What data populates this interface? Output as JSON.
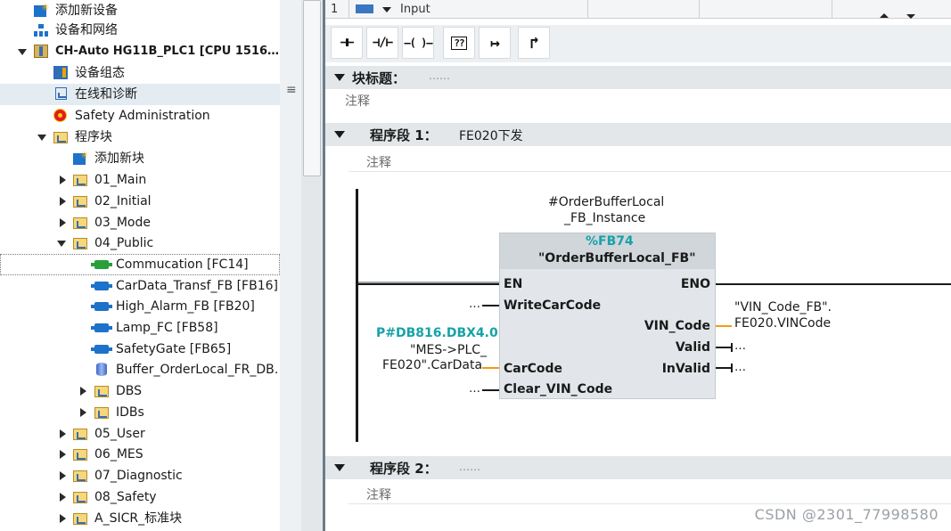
{
  "tree": {
    "items": [
      {
        "label": "添加新设备",
        "icon": "add-device-icon"
      },
      {
        "label": "设备和网络",
        "icon": "network-icon"
      },
      {
        "label": "CH-Auto HG11B_PLC1 [CPU 1516…",
        "icon": "plc-icon"
      },
      {
        "label": "设备组态",
        "icon": "device-config-icon"
      },
      {
        "label": "在线和诊断",
        "icon": "diagnostics-icon"
      },
      {
        "label": "Safety Administration",
        "icon": "safety-icon"
      },
      {
        "label": "程序块",
        "icon": "folder-icon"
      },
      {
        "label": "添加新块",
        "icon": "add-block-icon"
      },
      {
        "label": "01_Main",
        "icon": "folder-icon"
      },
      {
        "label": "02_Initial",
        "icon": "folder-icon"
      },
      {
        "label": "03_Mode",
        "icon": "folder-icon"
      },
      {
        "label": "04_Public",
        "icon": "folder-icon"
      },
      {
        "label": "Commucation [FC14]",
        "icon": "fc-block-icon"
      },
      {
        "label": "CarData_Transf_FB [FB16]",
        "icon": "fb-block-icon"
      },
      {
        "label": "High_Alarm_FB [FB20]",
        "icon": "fb-block-icon"
      },
      {
        "label": "Lamp_FC [FB58]",
        "icon": "fb-block-icon"
      },
      {
        "label": "SafetyGate [FB65]",
        "icon": "fb-block-icon"
      },
      {
        "label": "Buffer_OrderLocal_FR_DB…",
        "icon": "db-icon"
      },
      {
        "label": "DBS",
        "icon": "folder-icon"
      },
      {
        "label": "IDBs",
        "icon": "folder-icon"
      },
      {
        "label": "05_User",
        "icon": "folder-icon"
      },
      {
        "label": "06_MES",
        "icon": "folder-icon"
      },
      {
        "label": "07_Diagnostic",
        "icon": "folder-icon"
      },
      {
        "label": "08_Safety",
        "icon": "folder-icon"
      },
      {
        "label": "A_SICR_标准块",
        "icon": "folder-icon"
      }
    ]
  },
  "interface_strip": {
    "row_number": "1",
    "section_name": "Input"
  },
  "toolbar": {
    "buttons": [
      {
        "glyph": "⊣⊢",
        "name": "normally-open-contact"
      },
      {
        "glyph": "⊣/⊢",
        "name": "normally-closed-contact"
      },
      {
        "glyph": "–( )–",
        "name": "coil"
      },
      {
        "glyph": "??",
        "name": "empty-box"
      },
      {
        "glyph": "↦",
        "name": "open-branch"
      },
      {
        "glyph": "↱",
        "name": "close-branch"
      }
    ]
  },
  "block": {
    "title_label": "块标题：",
    "title_value": "……",
    "comment": "注释"
  },
  "networks": [
    {
      "label": "程序段 1：",
      "title": "FE020下发",
      "comment": "注释"
    },
    {
      "label": "程序段 2：",
      "title": "……",
      "comment": "注释"
    }
  ],
  "fb": {
    "instance_line1": "#OrderBufferLocal",
    "instance_line2": "_FB_Instance",
    "number": "%FB74",
    "name": "\"OrderBufferLocal_FB\"",
    "pins": {
      "en": "EN",
      "eno": "ENO",
      "write_car_code": "WriteCarCode",
      "vin_code": "VIN_Code",
      "valid": "Valid",
      "invalid": "InValid",
      "car_code": "CarCode",
      "clear_vin_code": "Clear_VIN_Code"
    },
    "operands": {
      "write_car_code": "…",
      "vin_code_line1": "\"VIN_Code_FB\".",
      "vin_code_line2": "FE020.VINCode",
      "valid": "…",
      "invalid": "…",
      "car_code_addr": "P#DB816.DBX4.0",
      "car_code_line1": "\"MES->PLC_",
      "car_code_line2": "FE020\".CarData",
      "clear_vin_code": "…"
    }
  },
  "watermark": "CSDN @2301_77998580"
}
